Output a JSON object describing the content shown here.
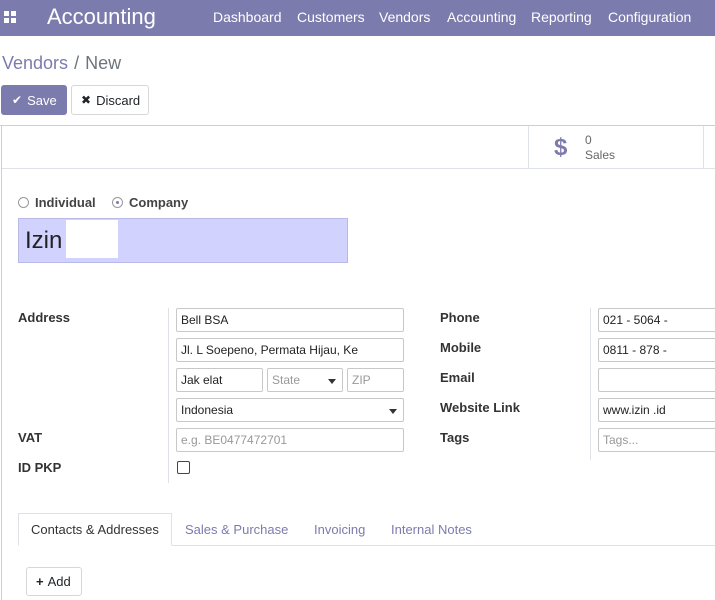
{
  "app": {
    "title": "Accounting"
  },
  "menu": [
    "Dashboard",
    "Customers",
    "Vendors",
    "Accounting",
    "Reporting",
    "Configuration"
  ],
  "breadcrumb": {
    "parent": "Vendors",
    "separator": "/",
    "current": "New"
  },
  "toolbar": {
    "save_label": "Save",
    "discard_label": "Discard"
  },
  "stat_button": {
    "value": "0",
    "label": "Sales"
  },
  "company_type": {
    "individual": "Individual",
    "company": "Company",
    "selected": "company"
  },
  "name": "Izin",
  "address": {
    "label": "Address",
    "street": "Bell     BSA",
    "street2": "Jl. L        Soepeno, Permata Hijau, Ke",
    "city": "Jak         elat",
    "state_placeholder": "State",
    "zip_placeholder": "ZIP",
    "country": "Indonesia"
  },
  "vat": {
    "label": "VAT",
    "placeholder": "e.g. BE0477472701"
  },
  "id_pkp": {
    "label": "ID PKP"
  },
  "contact": {
    "phone_label": "Phone",
    "phone": "021 - 5064 -",
    "mobile_label": "Mobile",
    "mobile": "0811 - 878 -",
    "email_label": "Email",
    "website_label": "Website Link",
    "website": "www.izin            .id",
    "tags_label": "Tags",
    "tags_placeholder": "Tags..."
  },
  "tabs": [
    "Contacts & Addresses",
    "Sales & Purchase",
    "Invoicing",
    "Internal Notes"
  ],
  "add_label": "Add",
  "colors": {
    "brand": "#7c7bad",
    "name_field": "#d2d2ff"
  }
}
